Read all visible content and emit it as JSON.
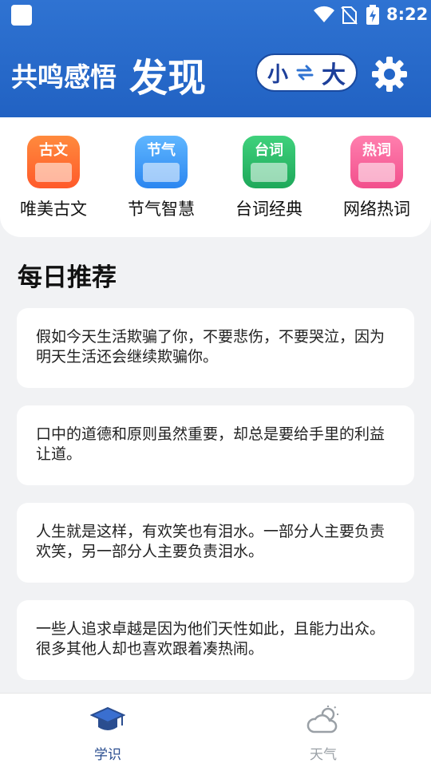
{
  "status": {
    "time": "8:22"
  },
  "header": {
    "subtitle": "共鸣感悟",
    "title": "发现"
  },
  "size_toggle": {
    "small": "小",
    "big": "大"
  },
  "categories": [
    {
      "tag": "古文",
      "label": "唯美古文",
      "color_top": "#ff8a3d",
      "color_bottom": "#ff5a2a"
    },
    {
      "tag": "节气",
      "label": "节气智慧",
      "color_top": "#5fb6ff",
      "color_bottom": "#2b86f0"
    },
    {
      "tag": "台词",
      "label": "台词经典",
      "color_top": "#3fd17c",
      "color_bottom": "#1ea85a"
    },
    {
      "tag": "热词",
      "label": "网络热词",
      "color_top": "#ff7fae",
      "color_bottom": "#f24f8c"
    }
  ],
  "section": {
    "title": "每日推荐"
  },
  "quotes": [
    "假如今天生活欺骗了你，不要悲伤，不要哭泣，因为明天生活还会继续欺骗你。",
    "口中的道德和原则虽然重要，却总是要给手里的利益让道。",
    "人生就是这样，有欢笑也有泪水。一部分人主要负责欢笑，另一部分人主要负责泪水。",
    "一些人追求卓越是因为他们天性如此，且能力出众。很多其他人却也喜欢跟着凑热闹。"
  ],
  "tabs": [
    {
      "label": "学识",
      "active": true,
      "icon": "graduation-cap-icon"
    },
    {
      "label": "天气",
      "active": false,
      "icon": "weather-icon"
    }
  ],
  "colors": {
    "accent": "#2a68cc",
    "tab_active": "#2a4d8f",
    "tab_inactive": "#9aa0a6"
  }
}
